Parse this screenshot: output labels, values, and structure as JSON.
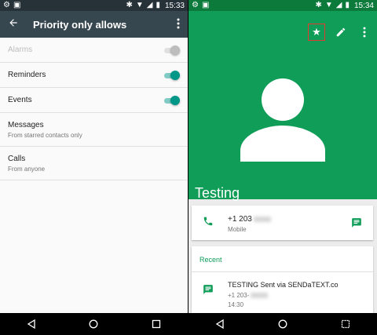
{
  "left": {
    "status": {
      "time": "15:33"
    },
    "appbar": {
      "title": "Priority only allows"
    },
    "settings": [
      {
        "label": "Alarms",
        "enabled": false,
        "toggle": "on-disabled"
      },
      {
        "label": "Reminders",
        "enabled": true,
        "toggle": "on"
      },
      {
        "label": "Events",
        "enabled": true,
        "toggle": "on"
      },
      {
        "label": "Messages",
        "sub": "From starred contacts only"
      },
      {
        "label": "Calls",
        "sub": "From anyone"
      }
    ]
  },
  "right": {
    "status": {
      "time": "15:34"
    },
    "contact": {
      "name": "Testing"
    },
    "phone": {
      "number_prefix": "+1 203",
      "type": "Mobile"
    },
    "recent": {
      "title": "Recent",
      "item": {
        "text": "TESTING Sent via SENDaTEXT.co",
        "number_prefix": "+1 203-",
        "time": "14:30"
      }
    }
  },
  "colors": {
    "accent_green": "#0f9d58",
    "toggle_teal": "#009688",
    "highlight_red": "#e53935"
  }
}
